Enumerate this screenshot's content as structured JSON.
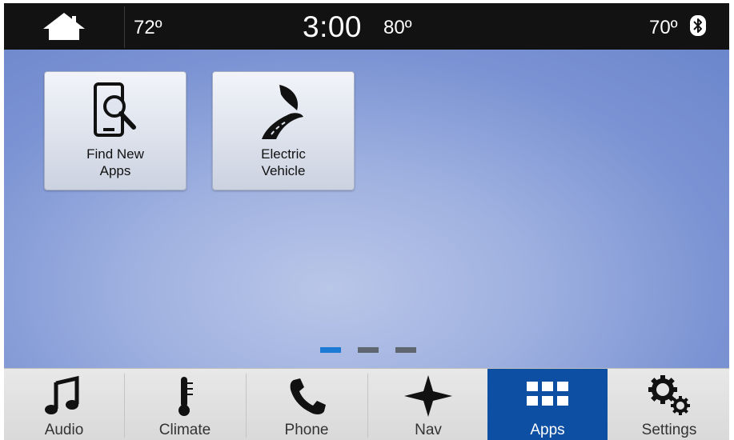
{
  "status_bar": {
    "driver_temp": "72º",
    "time": "3:00",
    "outside_temp": "80º",
    "passenger_temp": "70º",
    "icons": [
      "home-icon",
      "bluetooth-icon"
    ]
  },
  "apps": [
    {
      "label": "Find New\nApps",
      "icon": "phone-search-icon"
    },
    {
      "label": "Electric\nVehicle",
      "icon": "leaf-road-icon"
    }
  ],
  "pagination": {
    "pages": 3,
    "current": 1,
    "active_color": "#1a7ad4",
    "inactive_color": "#5f6670"
  },
  "nav": {
    "items": [
      {
        "label": "Audio",
        "icon": "music-note-icon"
      },
      {
        "label": "Climate",
        "icon": "thermometer-icon"
      },
      {
        "label": "Phone",
        "icon": "phone-handset-icon"
      },
      {
        "label": "Nav",
        "icon": "compass-star-icon"
      },
      {
        "label": "Apps",
        "icon": "apps-grid-icon"
      },
      {
        "label": "Settings",
        "icon": "gears-icon"
      }
    ],
    "active": "Apps",
    "active_color": "#0d4fa3"
  }
}
